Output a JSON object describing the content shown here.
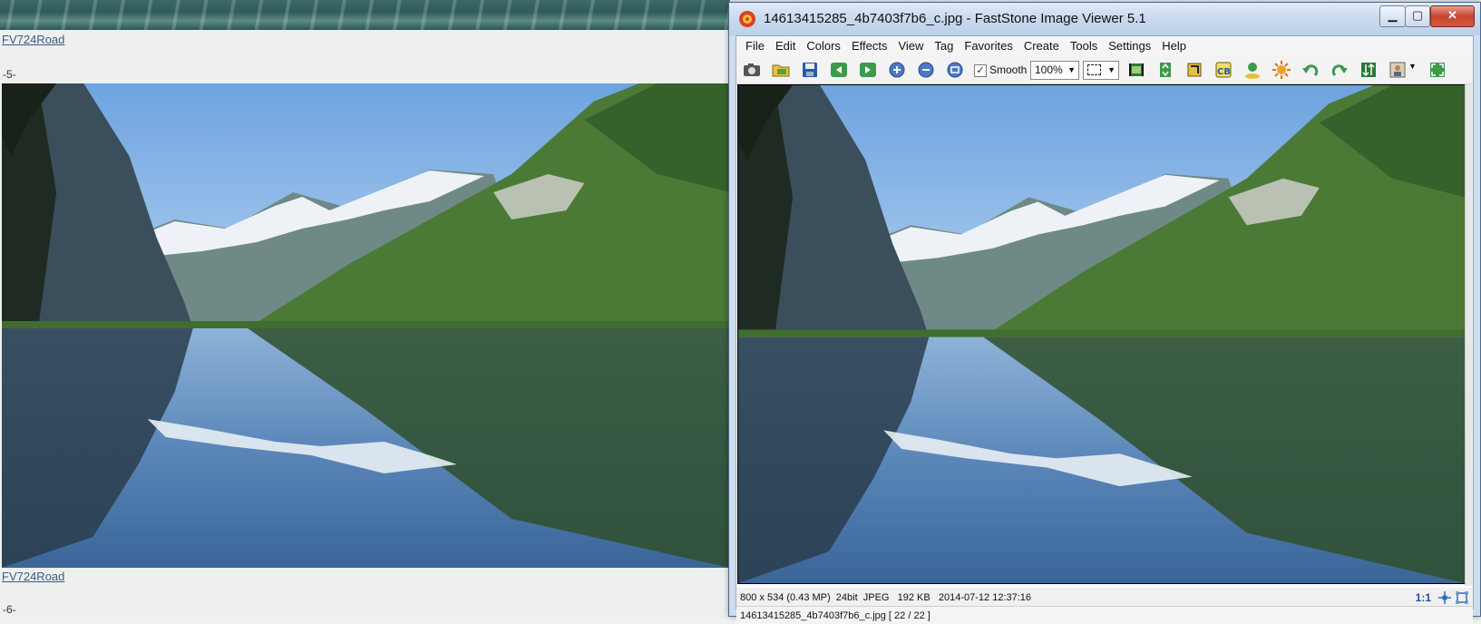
{
  "background_page": {
    "link_top": "FV724Road",
    "number_5": "-5-",
    "link_bottom": "FV724Road",
    "number_6": "-6-"
  },
  "window": {
    "title": "14613415285_4b7403f7b6_c.jpg  -  FastStone Image Viewer 5.1",
    "controls": {
      "minimize": "▁",
      "maximize": "▢",
      "close": "✕"
    }
  },
  "menu": [
    "File",
    "Edit",
    "Colors",
    "Effects",
    "View",
    "Tag",
    "Favorites",
    "Create",
    "Tools",
    "Settings",
    "Help"
  ],
  "toolbar": {
    "smooth_checked": "✓",
    "smooth_label": "Smooth",
    "zoom_value": "100%",
    "dropdown_arrow": "▼"
  },
  "status": {
    "info": "800 x 534 (0.43 MP)  24bit  JPEG   192 KB   2014-07-12 12:37:16",
    "ratio": "1:1",
    "file": "14613415285_4b7403f7b6_c.jpg [ 22 / 22 ]"
  },
  "colors": {
    "sky": "#8fbbe8",
    "water": "#4d78a8",
    "forest": "#3f6e2f",
    "snow": "#eef2f6",
    "title_bar": "#c9d9ee",
    "close_red": "#c8452f"
  }
}
